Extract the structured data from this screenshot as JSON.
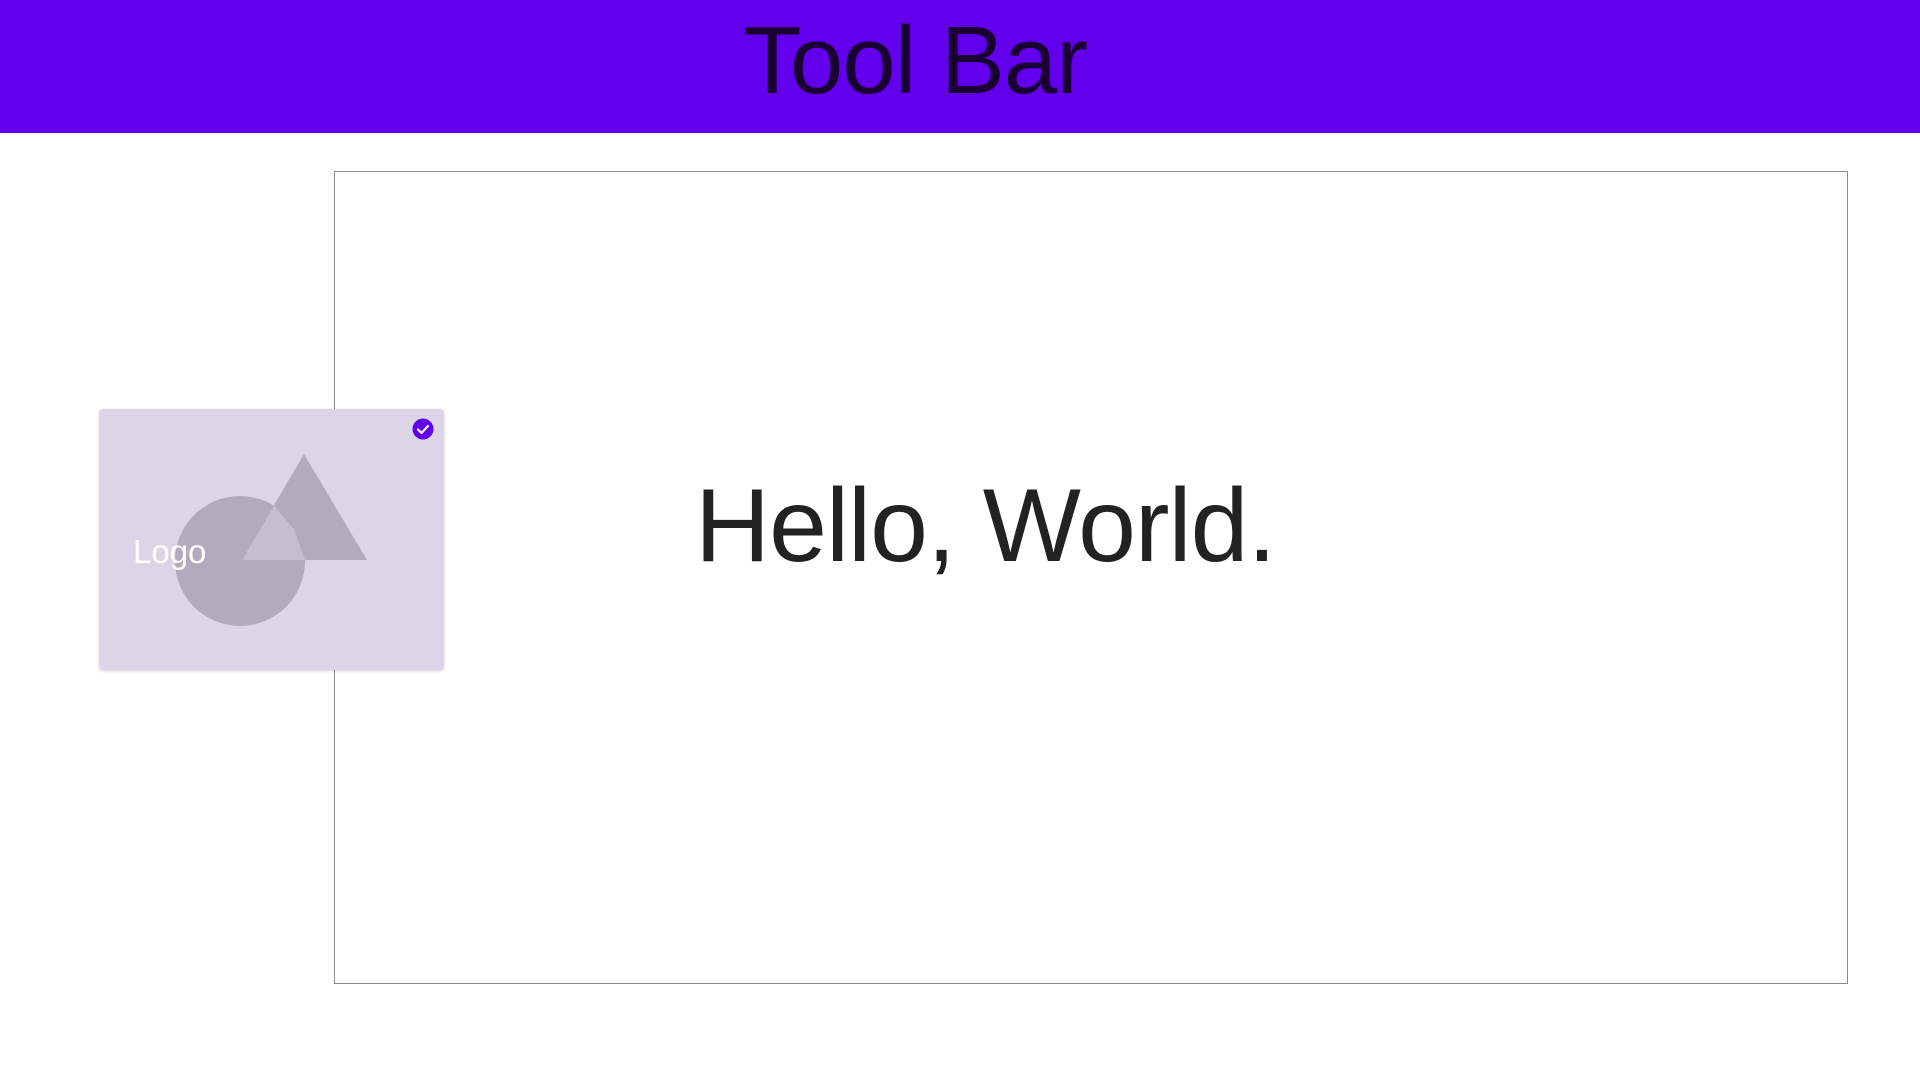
{
  "toolbar": {
    "title": "Tool Bar",
    "color": "#6200EE"
  },
  "canvas": {
    "greeting": "Hello, World."
  },
  "logo_card": {
    "label": "Logo",
    "placeholder_icon": "image-placeholder-icon",
    "selected_icon": "check-circle-icon",
    "selected": true,
    "background": "#DCD5E7",
    "shape_color": "#B2AABD"
  }
}
